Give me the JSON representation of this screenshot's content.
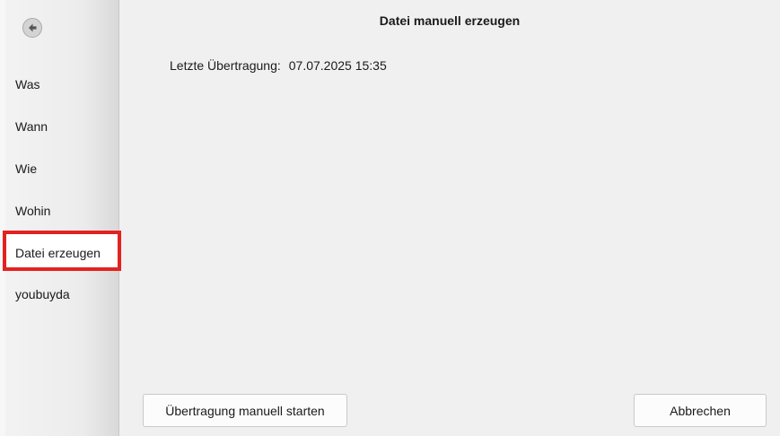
{
  "sidebar": {
    "back_icon": "arrow-left-icon",
    "items": [
      {
        "label": "Was",
        "selected": false
      },
      {
        "label": "Wann",
        "selected": false
      },
      {
        "label": "Wie",
        "selected": false
      },
      {
        "label": "Wohin",
        "selected": false
      },
      {
        "label": "Datei erzeugen",
        "selected": true
      },
      {
        "label": "youbuyda",
        "selected": false
      }
    ]
  },
  "main": {
    "title": "Datei manuell erzeugen",
    "last_transfer": {
      "label": "Letzte Übertragung:",
      "value": "07.07.2025 15:35"
    }
  },
  "buttons": {
    "start_label": "Übertragung manuell starten",
    "cancel_label": "Abbrechen"
  },
  "colors": {
    "highlight": "#e3221f",
    "background": "#f0f0f0"
  }
}
